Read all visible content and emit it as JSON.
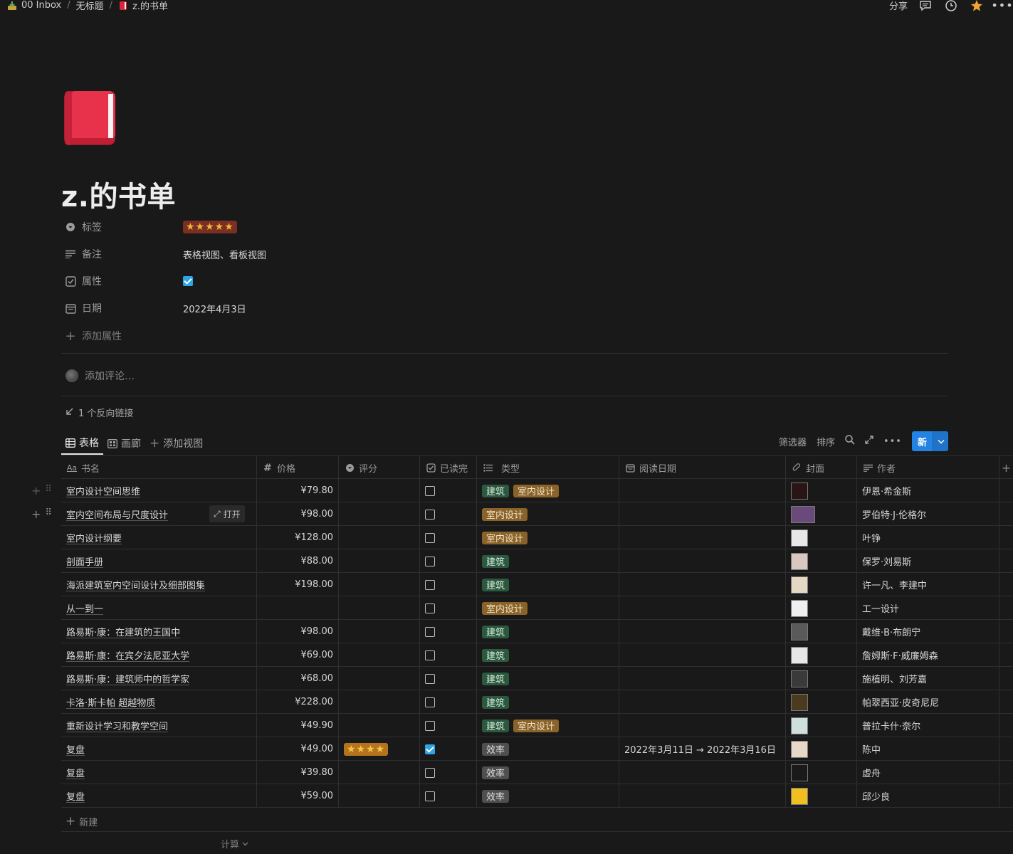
{
  "breadcrumb": {
    "items": [
      "00 Inbox",
      "无标题",
      "z.的书单"
    ]
  },
  "topbar": {
    "share_label": "分享"
  },
  "page": {
    "title": "z.的书单",
    "icon": "red-book-icon"
  },
  "properties": [
    {
      "name": "标签",
      "icon": "tag-icon",
      "value": "★★★★★"
    },
    {
      "name": "备注",
      "icon": "text-lines-icon",
      "value": "表格视图、看板视图"
    },
    {
      "name": "属性",
      "icon": "checkbox-icon",
      "value": true
    },
    {
      "name": "日期",
      "icon": "calendar-icon",
      "value": "2022年4月3日"
    }
  ],
  "add_property_label": "添加属性",
  "comment_placeholder": "添加评论…",
  "backlinks_label": "1 个反向链接",
  "views": {
    "tabs": [
      "表格",
      "画廊"
    ],
    "add_view_label": "添加视图",
    "filter_label": "筛选器",
    "sort_label": "排序",
    "new_label": "新"
  },
  "table": {
    "columns": [
      "书名",
      "价格",
      "评分",
      "已读完",
      "类型",
      "阅读日期",
      "封面",
      "作者"
    ],
    "open_label": "打开",
    "rows": [
      {
        "name": "室内设计空间思维",
        "price": "¥79.80",
        "rating": "",
        "read": false,
        "types": [
          "建筑",
          "室内设计"
        ],
        "date": "",
        "author": "伊恩·希金斯",
        "cover": "#2a1515"
      },
      {
        "name": "室内空间布局与尺度设计",
        "price": "¥98.00",
        "rating": "",
        "read": false,
        "types": [
          "室内设计"
        ],
        "date": "",
        "author": "罗伯特·J·伦格尔",
        "cover": "#6a4a7a"
      },
      {
        "name": "室内设计纲要",
        "price": "¥128.00",
        "rating": "",
        "read": false,
        "types": [
          "室内设计"
        ],
        "date": "",
        "author": "叶铮",
        "cover": "#e8e8e8"
      },
      {
        "name": "剖面手册",
        "price": "¥88.00",
        "rating": "",
        "read": false,
        "types": [
          "建筑"
        ],
        "date": "",
        "author": "保罗·刘易斯",
        "cover": "#d8c8c0"
      },
      {
        "name": "海派建筑室内空间设计及细部图集",
        "price": "¥198.00",
        "rating": "",
        "read": false,
        "types": [
          "建筑"
        ],
        "date": "",
        "author": "许一凡、李建中",
        "cover": "#e4d8c4"
      },
      {
        "name": "从一到一",
        "price": "",
        "rating": "",
        "read": false,
        "types": [
          "室内设计"
        ],
        "date": "",
        "author": "工一设计",
        "cover": "#efefef"
      },
      {
        "name": "路易斯·康：在建筑的王国中",
        "price": "¥98.00",
        "rating": "",
        "read": false,
        "types": [
          "建筑"
        ],
        "date": "",
        "author": "戴维·B·布朗宁",
        "cover": "#5a5a5a"
      },
      {
        "name": "路易斯·康：在宾夕法尼亚大学",
        "price": "¥69.00",
        "rating": "",
        "read": false,
        "types": [
          "建筑"
        ],
        "date": "",
        "author": "詹姆斯·F·威廉姆森",
        "cover": "#e6e6e6"
      },
      {
        "name": "路易斯·康：建筑师中的哲学家",
        "price": "¥68.00",
        "rating": "",
        "read": false,
        "types": [
          "建筑"
        ],
        "date": "",
        "author": "施植明、刘芳嘉",
        "cover": "#3a3a3a"
      },
      {
        "name": "卡洛·斯卡帕 超越物质",
        "price": "¥228.00",
        "rating": "",
        "read": false,
        "types": [
          "建筑"
        ],
        "date": "",
        "author": "帕翠西亚·皮奇尼尼",
        "cover": "#4a3a20"
      },
      {
        "name": "重新设计学习和教学空间",
        "price": "¥49.90",
        "rating": "",
        "read": false,
        "types": [
          "建筑",
          "室内设计"
        ],
        "date": "",
        "author": "普拉卡什·奈尔",
        "cover": "#cfe0dc"
      },
      {
        "name": "复盘",
        "price": "¥49.00",
        "rating": "★★★★",
        "read": true,
        "types": [
          "效率"
        ],
        "date": "2022年3月11日 → 2022年3月16日",
        "author": "陈中",
        "cover": "#e8d8c8"
      },
      {
        "name": "复盘",
        "price": "¥39.80",
        "rating": "",
        "read": false,
        "types": [
          "效率"
        ],
        "date": "",
        "author": "虚舟",
        "cover": "#1a1a1a"
      },
      {
        "name": "复盘",
        "price": "¥59.00",
        "rating": "",
        "read": false,
        "types": [
          "效率"
        ],
        "date": "",
        "author": "邱少良",
        "cover": "#f0c020"
      }
    ]
  },
  "new_row_label": "新建",
  "calc_label": "计算",
  "tag_colors": {
    "建筑": "#2b593f",
    "室内设计": "#89632a",
    "效率": "#4f4f4f"
  }
}
